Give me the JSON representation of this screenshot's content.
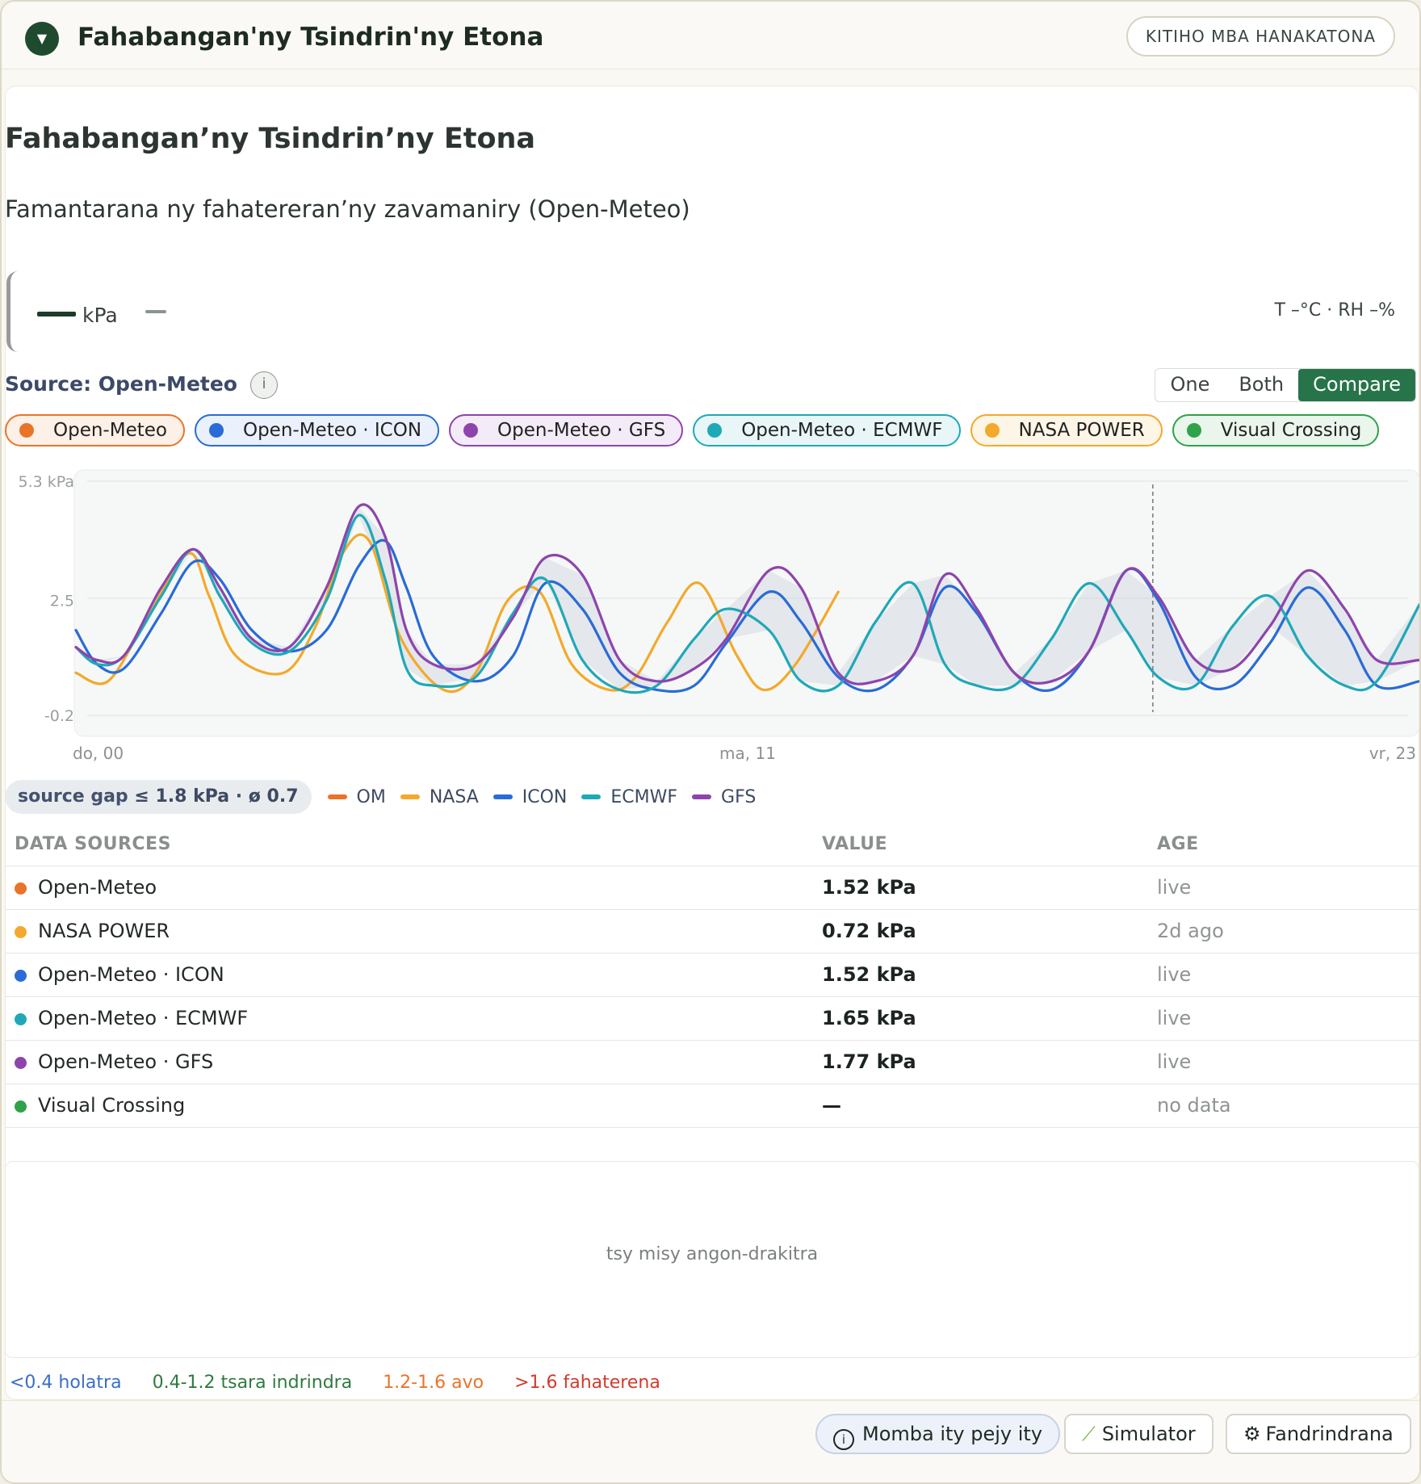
{
  "header": {
    "title": "Fahabangan'ny Tsindrin'ny Etona",
    "action_label": "KITIHO MBA HANAKATONA"
  },
  "page": {
    "title": "Fahabangan’ny Tsindrin’ny Etona",
    "subtitle": "Famantarana ny fahatereran’ny zavamaniry (Open-Meteo)"
  },
  "reading": {
    "value": "—",
    "unit": "kPa",
    "secondary": "—",
    "temp_rh": "T –°C · RH –%"
  },
  "source": {
    "label": "Source: Open-Meteo",
    "info_glyph": "i",
    "modes": [
      "One",
      "Both",
      "Compare"
    ],
    "active_mode": "Compare"
  },
  "chips": [
    {
      "label": "Open-Meteo",
      "color": "#e8742a",
      "bg": "#fdf0e6"
    },
    {
      "label": "Open-Meteo · ICON",
      "color": "#2a6bd6",
      "bg": "#eaf1fc"
    },
    {
      "label": "Open-Meteo · GFS",
      "color": "#8e44ad",
      "bg": "#f4ebf8"
    },
    {
      "label": "Open-Meteo · ECMWF",
      "color": "#1fa8b8",
      "bg": "#e8f6f8"
    },
    {
      "label": "NASA POWER",
      "color": "#f3a92b",
      "bg": "#fdf5e6"
    },
    {
      "label": "Visual Crossing",
      "color": "#2fa24a",
      "bg": "#eaf6ec"
    }
  ],
  "chart_data": {
    "type": "line",
    "ylabel": "",
    "unit": "kPa",
    "ylim": [
      -0.2,
      5.3
    ],
    "y_ticks": [
      "5.3 kPa",
      "2.5",
      "-0.2"
    ],
    "x_ticks": [
      "do, 00",
      "ma, 11",
      "vr, 23"
    ],
    "x_range_hours": [
      0,
      252
    ],
    "now_marker_hours": 202,
    "series": [
      {
        "name": "NASA",
        "color": "#f3a92b",
        "x": [
          0,
          6,
          13,
          21,
          25,
          30,
          39,
          45,
          50,
          55,
          61,
          69,
          75,
          81,
          87,
          93,
          100,
          105,
          111,
          117,
          124,
          129,
          135,
          143
        ],
        "y": [
          0.8,
          0.6,
          2.0,
          3.6,
          2.6,
          1.2,
          0.8,
          1.9,
          3.6,
          3.9,
          1.6,
          0.4,
          0.8,
          2.5,
          2.7,
          1.0,
          0.4,
          0.7,
          2.0,
          2.9,
          1.2,
          0.4,
          1.0,
          2.7
        ]
      },
      {
        "name": "ICON",
        "color": "#2a6bd6",
        "x": [
          0,
          4,
          9,
          16,
          22,
          27,
          33,
          40,
          47,
          53,
          58,
          62,
          67,
          75,
          82,
          88,
          95,
          102,
          109,
          116,
          122,
          130,
          136,
          143,
          150,
          157,
          163,
          169,
          176,
          183,
          190,
          197,
          203,
          210,
          217,
          224,
          231,
          238,
          244,
          252
        ],
        "y": [
          1.8,
          1.0,
          0.9,
          2.2,
          3.4,
          3.0,
          1.8,
          1.3,
          1.8,
          3.3,
          3.9,
          2.8,
          1.2,
          0.6,
          1.2,
          2.9,
          2.3,
          0.8,
          0.4,
          0.5,
          1.5,
          2.7,
          2.0,
          0.7,
          0.4,
          1.2,
          2.8,
          2.2,
          0.8,
          0.4,
          1.3,
          3.2,
          2.5,
          0.7,
          0.5,
          1.5,
          2.8,
          1.8,
          0.5,
          0.6
        ]
      },
      {
        "name": "ECMWF",
        "color": "#1fa8b8",
        "x": [
          0,
          4,
          9,
          16,
          22,
          27,
          33,
          40,
          47,
          53,
          58,
          62,
          67,
          75,
          82,
          88,
          95,
          102,
          109,
          116,
          122,
          130,
          136,
          143,
          150,
          157,
          163,
          169,
          176,
          183,
          190,
          197,
          203,
          210,
          217,
          224,
          231,
          238,
          244,
          252
        ],
        "y": [
          1.4,
          1.0,
          1.2,
          2.6,
          3.7,
          2.6,
          1.5,
          1.3,
          2.5,
          4.5,
          3.0,
          0.9,
          0.5,
          0.7,
          2.2,
          3.0,
          1.1,
          0.4,
          0.5,
          1.6,
          2.3,
          1.8,
          0.6,
          0.5,
          2.0,
          2.9,
          1.0,
          0.5,
          0.5,
          1.6,
          2.9,
          1.8,
          0.7,
          0.5,
          1.9,
          2.6,
          1.2,
          0.5,
          0.6,
          2.4
        ]
      },
      {
        "name": "GFS",
        "color": "#8e44ad",
        "x": [
          0,
          4,
          9,
          16,
          22,
          27,
          33,
          40,
          47,
          53,
          58,
          62,
          67,
          75,
          82,
          88,
          95,
          102,
          109,
          116,
          122,
          130,
          136,
          143,
          150,
          157,
          163,
          169,
          176,
          183,
          190,
          197,
          203,
          210,
          217,
          224,
          231,
          238,
          244,
          252
        ],
        "y": [
          1.4,
          1.1,
          1.2,
          2.8,
          3.7,
          2.8,
          1.6,
          1.4,
          2.8,
          4.7,
          4.0,
          1.8,
          1.0,
          1.0,
          2.1,
          3.5,
          3.1,
          1.1,
          0.6,
          0.9,
          1.6,
          3.2,
          2.8,
          0.8,
          0.6,
          1.2,
          3.1,
          2.3,
          0.8,
          0.6,
          1.3,
          3.2,
          2.6,
          1.1,
          0.9,
          1.9,
          3.2,
          2.3,
          1.1,
          1.1
        ]
      }
    ]
  },
  "source_gap": {
    "label": "source gap",
    "value": "≤ 1.8 kPa · ø 0.7"
  },
  "legend": [
    {
      "label": "OM",
      "color": "#e8742a"
    },
    {
      "label": "NASA",
      "color": "#f3a92b"
    },
    {
      "label": "ICON",
      "color": "#2a6bd6"
    },
    {
      "label": "ECMWF",
      "color": "#1fa8b8"
    },
    {
      "label": "GFS",
      "color": "#8e44ad"
    }
  ],
  "table": {
    "headers": [
      "DATA SOURCES",
      "VALUE",
      "AGE"
    ],
    "rows": [
      {
        "source": "Open-Meteo",
        "color": "#e8742a",
        "value": "1.52 kPa",
        "age": "live"
      },
      {
        "source": "NASA POWER",
        "color": "#f3a92b",
        "value": "0.72 kPa",
        "age": "2d ago"
      },
      {
        "source": "Open-Meteo · ICON",
        "color": "#2a6bd6",
        "value": "1.52 kPa",
        "age": "live"
      },
      {
        "source": "Open-Meteo · ECMWF",
        "color": "#1fa8b8",
        "value": "1.65 kPa",
        "age": "live"
      },
      {
        "source": "Open-Meteo · GFS",
        "color": "#8e44ad",
        "value": "1.77 kPa",
        "age": "live"
      },
      {
        "source": "Visual Crossing",
        "color": "#2fa24a",
        "value": "—",
        "age": "no data"
      }
    ]
  },
  "empty_state": "tsy misy angon-drakitra",
  "scale": [
    {
      "label": "<0.4 holatra",
      "color": "#3a6fc4"
    },
    {
      "label": "0.4-1.2 tsara indrindra",
      "color": "#2f7a3e"
    },
    {
      "label": "1.2-1.6 avo",
      "color": "#e8742a"
    },
    {
      "label": ">1.6 fahaterena",
      "color": "#d33a2c"
    }
  ],
  "footer": {
    "info_label": "Momba ity pejy ity",
    "simulator_label": "Simulator",
    "settings_label": "Fandrindrana"
  }
}
